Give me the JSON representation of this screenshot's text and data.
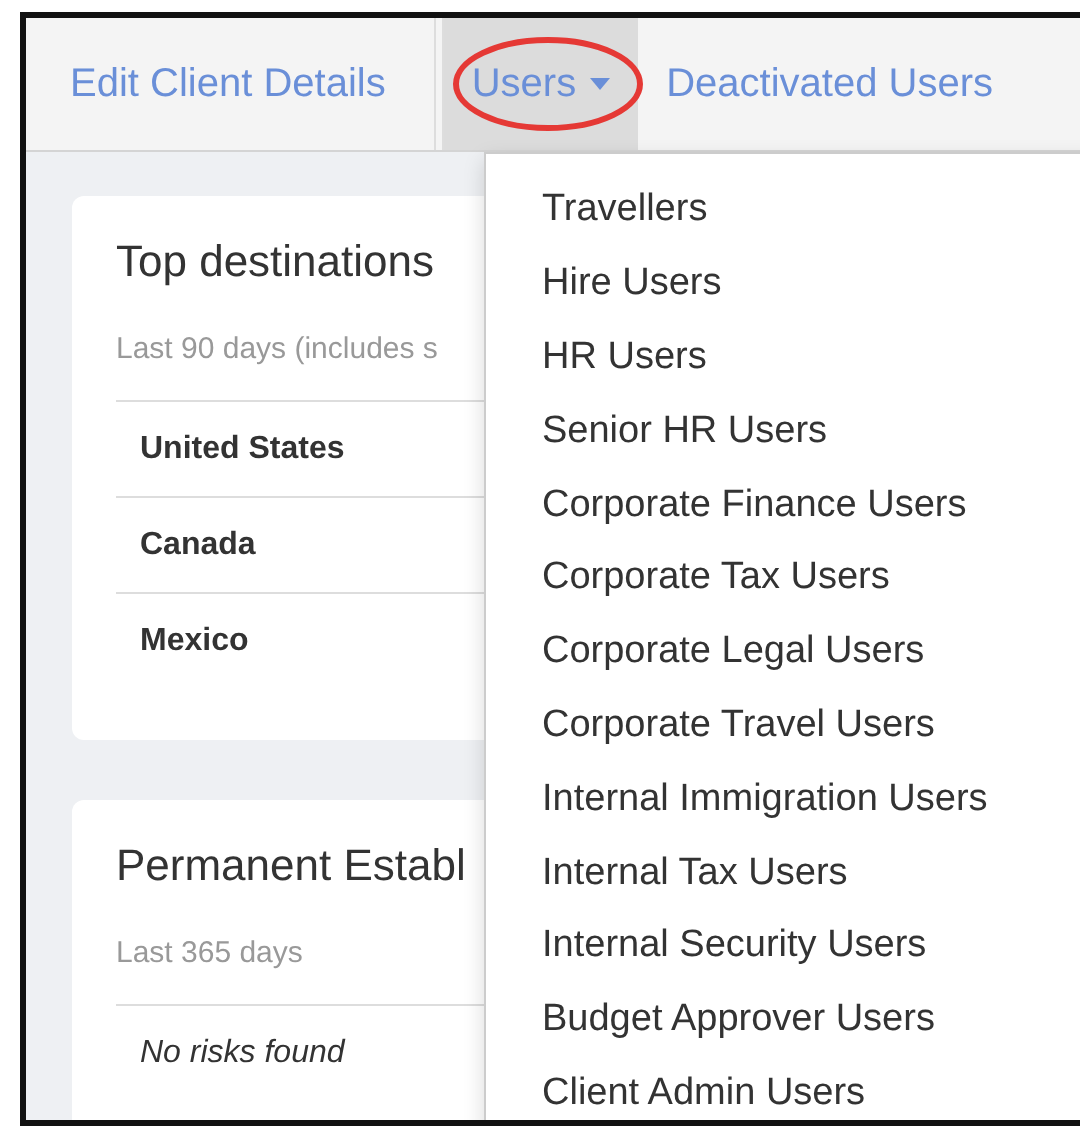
{
  "nav": {
    "tabs": [
      {
        "label": "Edit Client Details",
        "selected": false,
        "kind": "link",
        "highlighted": false
      },
      {
        "label": "Users",
        "selected": true,
        "kind": "dropdown",
        "highlighted": true
      },
      {
        "label": "Deactivated Users",
        "selected": false,
        "kind": "link",
        "highlighted": false
      }
    ]
  },
  "cards": [
    {
      "title": "Top destinations",
      "subtitle": "Last 90 days (includes s",
      "rows": [
        {
          "text": "United States",
          "kind": "country"
        },
        {
          "text": "Canada",
          "kind": "country"
        },
        {
          "text": "Mexico",
          "kind": "country"
        }
      ]
    },
    {
      "title": "Permanent Establ",
      "subtitle": "Last 365 days",
      "rows": [
        {
          "text": "No risks found",
          "kind": "empty"
        }
      ]
    }
  ],
  "dropdown": {
    "open": true,
    "items": [
      "Travellers",
      "Hire Users",
      "HR Users",
      "Senior HR Users",
      "Corporate Finance Users",
      "Corporate Tax Users",
      "Corporate Legal Users",
      "Corporate Travel Users",
      "Internal Immigration Users",
      "Internal Tax Users",
      "Internal Security Users",
      "Budget Approver Users",
      "Client Admin Users"
    ]
  }
}
